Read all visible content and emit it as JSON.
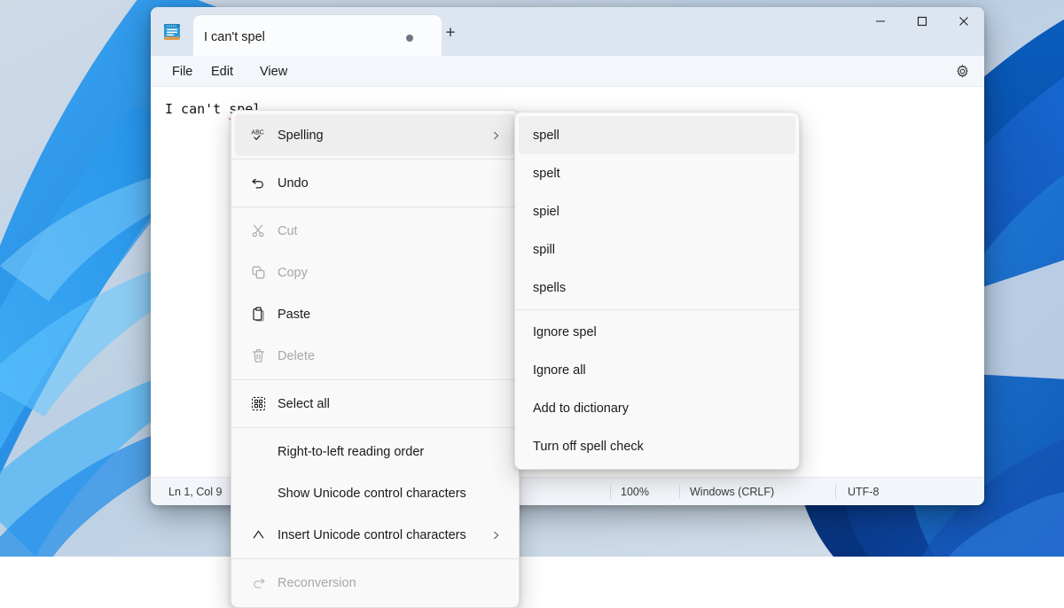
{
  "window": {
    "app_icon": "notepad-icon",
    "tab_title": "I can't spel",
    "tab_modified_indicator": "unsaved-dot",
    "new_tab_label": "+",
    "controls": {
      "minimize": "minimize-icon",
      "maximize": "maximize-icon",
      "close": "close-icon"
    }
  },
  "menubar": {
    "items": [
      {
        "label": "File"
      },
      {
        "label": "Edit"
      },
      {
        "label": "View"
      }
    ],
    "settings_icon": "gear-icon"
  },
  "editor": {
    "text_prefix": "I can't ",
    "misspelled_word": "spel"
  },
  "statusbar": {
    "cursor": "Ln 1, Col 9",
    "zoom": "100%",
    "line_ending": "Windows (CRLF)",
    "encoding": "UTF-8"
  },
  "context_menu": {
    "items": [
      {
        "label": "Spelling",
        "icon": "spellcheck-icon",
        "state": "highlight",
        "submenu": true
      },
      {
        "label": "Undo",
        "icon": "undo-icon",
        "state": "enabled",
        "submenu": false
      },
      {
        "label": "Cut",
        "icon": "scissors-icon",
        "state": "disabled",
        "submenu": false
      },
      {
        "label": "Copy",
        "icon": "copy-icon",
        "state": "disabled",
        "submenu": false
      },
      {
        "label": "Paste",
        "icon": "clipboard-icon",
        "state": "enabled",
        "submenu": false
      },
      {
        "label": "Delete",
        "icon": "trash-icon",
        "state": "disabled",
        "submenu": false
      },
      {
        "label": "Select all",
        "icon": "select-all-icon",
        "state": "enabled",
        "submenu": false
      },
      {
        "label": "Right-to-left reading order",
        "icon": "",
        "state": "enabled",
        "submenu": false
      },
      {
        "label": "Show Unicode control characters",
        "icon": "",
        "state": "enabled",
        "submenu": false
      },
      {
        "label": "Insert Unicode control characters",
        "icon": "caret-up-icon",
        "state": "enabled",
        "submenu": true
      },
      {
        "label": "Reconversion",
        "icon": "reconversion-icon",
        "state": "disabled",
        "submenu": false
      }
    ]
  },
  "spelling_submenu": {
    "suggestions": [
      {
        "label": "spell",
        "state": "highlight"
      },
      {
        "label": "spelt",
        "state": "enabled"
      },
      {
        "label": "spiel",
        "state": "enabled"
      },
      {
        "label": "spill",
        "state": "enabled"
      },
      {
        "label": "spells",
        "state": "enabled"
      }
    ],
    "actions": [
      {
        "label": "Ignore spel"
      },
      {
        "label": "Ignore all"
      },
      {
        "label": "Add to dictionary"
      },
      {
        "label": "Turn off spell check"
      }
    ]
  },
  "colors": {
    "accent_blue": "#1e8bdc",
    "misspell_red": "#e02b2b",
    "window_bg": "#f7f9fc",
    "titlebar_bg": "#dde5f0",
    "menu_bg": "#f9f9f9"
  }
}
